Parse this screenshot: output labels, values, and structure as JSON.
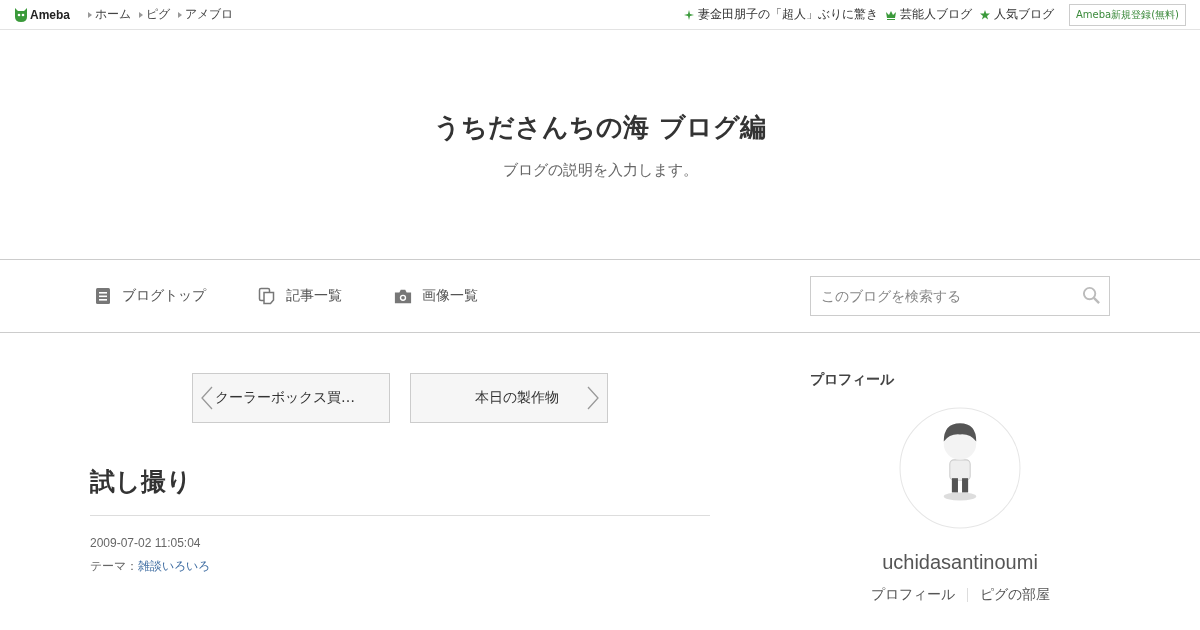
{
  "header": {
    "logo": "Ameba",
    "links": [
      "ホーム",
      "ピグ",
      "アメブロ"
    ],
    "right_links": [
      {
        "kind": "sparkle",
        "label": "妻金田朋子の「超人」ぶりに驚き"
      },
      {
        "kind": "crown",
        "label": "芸能人ブログ"
      },
      {
        "kind": "star",
        "label": "人気ブログ"
      }
    ],
    "register_button": "Ameba新規登録(無料)"
  },
  "blog": {
    "title": "うちださんちの海 ブログ編",
    "description": "ブログの説明を入力します。"
  },
  "nav": {
    "items": [
      {
        "kind": "doc",
        "label": "ブログトップ"
      },
      {
        "kind": "copy",
        "label": "記事一覧"
      },
      {
        "kind": "camera",
        "label": "画像一覧"
      }
    ],
    "search": {
      "placeholder": "このブログを検索する"
    }
  },
  "pager": {
    "prev": "クーラーボックス買…",
    "next": "本日の製作物"
  },
  "entry": {
    "title": "試し撮り",
    "date": "2009-07-02 11:05:04",
    "theme_label": "テーマ：",
    "theme": "雑談いろいろ"
  },
  "profile": {
    "heading": "プロフィール",
    "name": "uchidasantinoumi",
    "links": [
      "プロフィール",
      "ピグの部屋"
    ]
  }
}
